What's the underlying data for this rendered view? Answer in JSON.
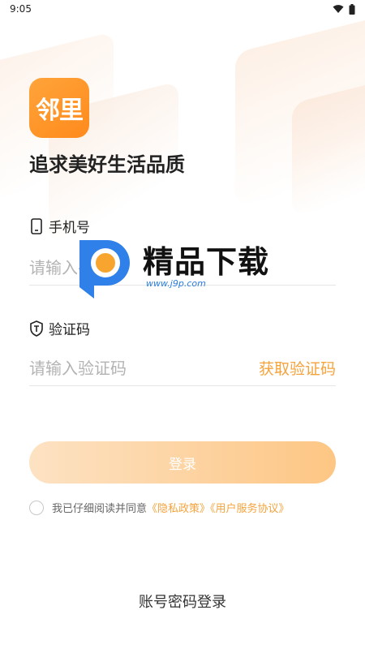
{
  "status_bar": {
    "time": "9:05",
    "wifi_icon": "wifi-icon",
    "battery_icon": "battery-icon"
  },
  "app": {
    "logo_text": "邻里",
    "slogan": "追求美好生活品质"
  },
  "phone": {
    "label": "手机号",
    "placeholder": "请输入手机号",
    "icon": "phone-icon"
  },
  "code": {
    "label": "验证码",
    "placeholder": "请输入验证码",
    "icon": "shield-icon",
    "get_code": "获取验证码"
  },
  "login_button": {
    "label": "登录"
  },
  "agreement": {
    "text": "我已仔细阅读并同意",
    "privacy_link": "《隐私政策》",
    "service_link": "《用户服务协议》"
  },
  "alt_login": {
    "label": "账号密码登录"
  },
  "watermark": {
    "title": "精品下载",
    "url": "www.j9p.com"
  },
  "colors": {
    "accent": "#f5a33d",
    "button_start": "#fde2c3",
    "button_end": "#fdc684",
    "logo": "#ff9a2a"
  }
}
